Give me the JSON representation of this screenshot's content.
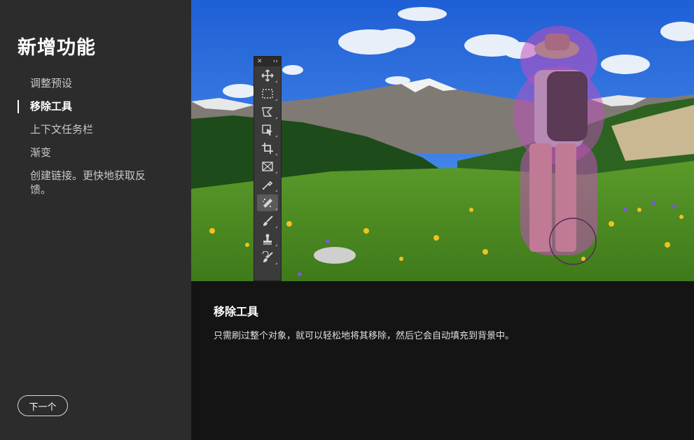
{
  "sidebar": {
    "title": "新增功能",
    "items": [
      {
        "label": "调整预设"
      },
      {
        "label": "移除工具"
      },
      {
        "label": "上下文任务栏"
      },
      {
        "label": "渐变"
      },
      {
        "label": "创建链接。更快地获取反馈。"
      }
    ],
    "active_index": 1,
    "next_label": "下一个"
  },
  "toolbar": {
    "close_glyph": "✕",
    "collapse_glyph": "››",
    "tools": [
      "move-icon",
      "marquee-icon",
      "lasso-icon",
      "object-select-icon",
      "crop-icon",
      "frame-icon",
      "eyedropper-icon",
      "remove-tool-icon",
      "brush-icon",
      "stamp-icon",
      "history-brush-icon"
    ],
    "active_tool": "remove-tool-icon"
  },
  "feature": {
    "title": "移除工具",
    "description": "只需刷过整个对象，就可以轻松地将其移除，然后它会自动填充到背景中。"
  },
  "colors": {
    "sidebar_bg": "#2c2c2c",
    "content_bg": "#141414",
    "selection_overlay": "#c24ec0"
  }
}
